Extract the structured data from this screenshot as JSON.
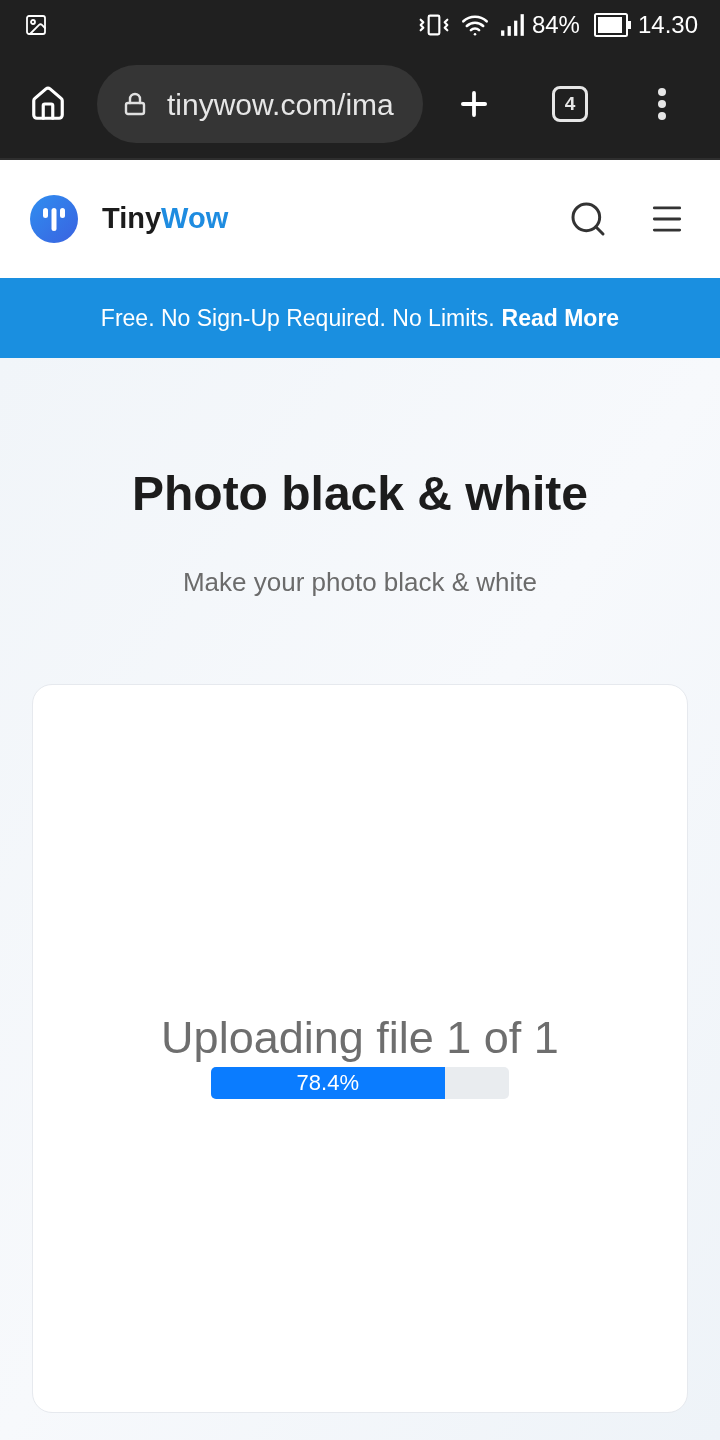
{
  "status_bar": {
    "battery": "84%",
    "time": "14.30"
  },
  "browser": {
    "url": "tinywow.com/ima",
    "tab_count": "4"
  },
  "header": {
    "logo": {
      "first": "Tiny",
      "second": "Wow"
    }
  },
  "banner": {
    "text": "Free. No Sign-Up Required. No Limits.",
    "link": "Read More"
  },
  "hero": {
    "title": "Photo black & white",
    "subtitle": "Make your photo black & white"
  },
  "upload": {
    "status": "Uploading file 1 of 1",
    "reading": "78.4%",
    "level": 0.784
  }
}
